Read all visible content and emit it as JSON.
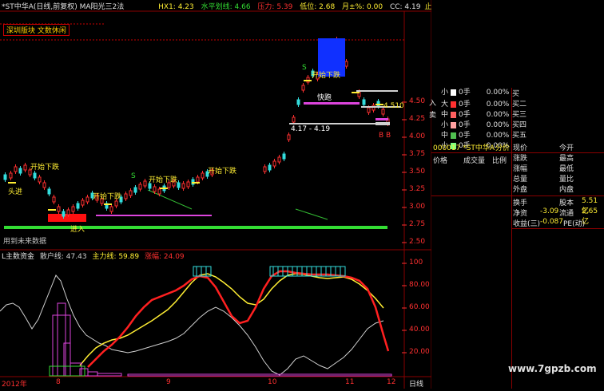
{
  "header": {
    "title": "*ST中华A(日线,前复权) MA阳光三2法",
    "hx1": "HX1: 4.23",
    "shuiping": "水平划线: 4.66",
    "yaoli": "压力: 5.39",
    "dizi": "低位: 2.68",
    "yue": "月±%: 0.00",
    "cc": "CC: 4.19",
    "cc_mark": "止"
  },
  "note_box": "深圳版块 文数休闲",
  "main_labels": {
    "kaishi1": "开始下跌",
    "kaishi2": "开始下跌",
    "kaishi3": "开始下跌",
    "kaishi4": "开始下跌",
    "kaishi5": "开始下跌",
    "tou": "头进",
    "jinru": "进入",
    "kuaipao": "快跑",
    "range": "4.17 - 4.19",
    "level": "4.510",
    "s": "S",
    "b": "B",
    "bb": "B B",
    "use_data": "用到未来数据"
  },
  "price_axis": [
    "4.50",
    "4.25",
    "4.00",
    "3.75",
    "3.50",
    "3.25",
    "3.00",
    "2.75",
    "2.50"
  ],
  "indicator": {
    "name": "L主数资金",
    "sanhu": "散户线: 47.43",
    "zhuli": "主力线: 59.89",
    "zhengfu": "涨幅: 24.09",
    "axis": [
      "100",
      "80.00",
      "60.00",
      "40.00",
      "20.00"
    ]
  },
  "time_axis": {
    "year": "2012年",
    "months": [
      "8",
      "9",
      "10",
      "11",
      "12"
    ],
    "period": "日线"
  },
  "order_book": {
    "ru": "入",
    "mai": "卖",
    "rows": [
      {
        "side": "",
        "size": "小",
        "vol": "0手",
        "pct": "0.00%",
        "color": "#ffffff"
      },
      {
        "side": "",
        "size": "大",
        "vol": "0手",
        "pct": "0.00%",
        "color": "#ff3030"
      },
      {
        "side": "",
        "size": "中",
        "vol": "0手",
        "pct": "0.00%",
        "color": "#ff6060"
      },
      {
        "side": "",
        "size": "小",
        "vol": "0手",
        "pct": "0.00%",
        "color": "#ffa0a0"
      },
      {
        "side": "",
        "size": "中",
        "vol": "0手",
        "pct": "0.00%",
        "color": "#50c050"
      },
      {
        "side": "",
        "size": "小",
        "vol": "0手",
        "pct": "0.00%",
        "color": "#80ff80"
      }
    ],
    "buy_labels": [
      "买",
      "买二",
      "买三",
      "买四",
      "买五"
    ]
  },
  "quote": {
    "code_title": "000017 *ST中华A",
    "fen_jia": "分价",
    "cols": [
      "价格",
      "成交量",
      "比例"
    ],
    "left_labels": [
      "现价",
      "涨跌",
      "涨幅",
      "总量",
      "外盘"
    ],
    "right_labels": [
      "今开",
      "最高",
      "最低",
      "量比",
      "内盘"
    ],
    "huanshou": "换手",
    "guben": "股本",
    "guben_val": "5.51亿",
    "jingzi": "净资",
    "jingzi_val": "-3.09",
    "liutong": "流通",
    "liutong_val": "2.65亿",
    "shouyi": "收益(三)",
    "shouyi_val": "-0.087",
    "pe": "PE(动)"
  },
  "watermark": "www.7gpzb.com"
}
